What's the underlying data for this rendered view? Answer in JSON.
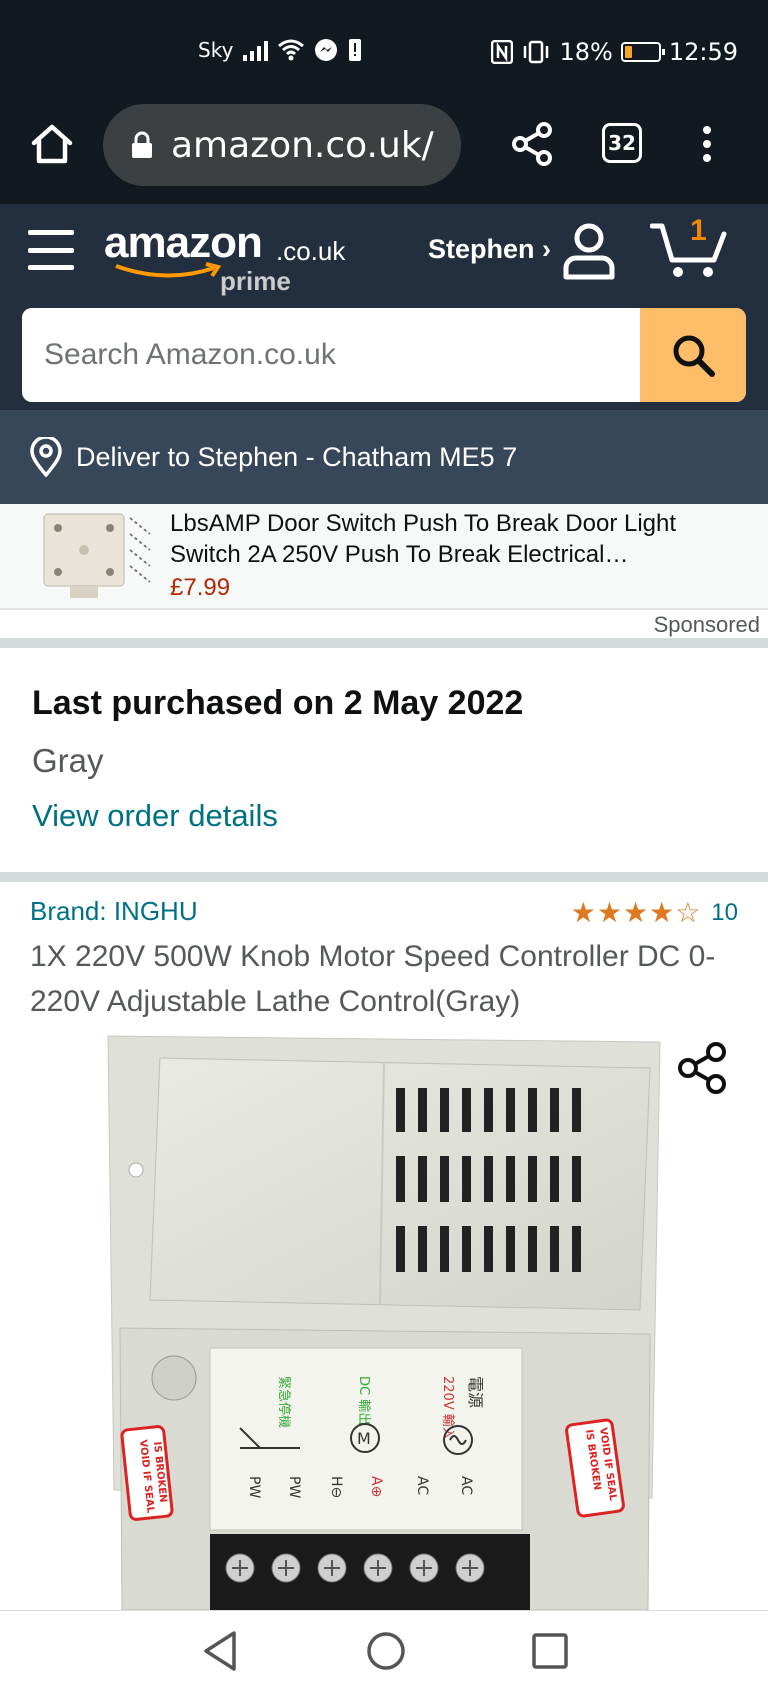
{
  "status_bar": {
    "carrier": "Sky",
    "battery_pct": "18%",
    "battery_level": 0.18,
    "time": "12:59"
  },
  "browser": {
    "url": "amazon.co.uk/",
    "tab_count": "32",
    "icons": [
      "home-icon",
      "lock-icon",
      "share-icon",
      "tabs-icon",
      "more-vert-icon"
    ]
  },
  "header": {
    "logo_text": "amazon",
    "logo_tld": ".co.uk",
    "logo_sub": "prime",
    "account_name": "Stephen ›",
    "cart_count": "1",
    "search_placeholder": "Search Amazon.co.uk"
  },
  "deliver": {
    "text": "Deliver to Stephen - Chatham ME5 7"
  },
  "ad": {
    "title": "LbsAMP Door Switch Push To Break Door Light Switch 2A 250V Push To Break Electrical…",
    "price": "£7.99",
    "sponsored_label": "Sponsored"
  },
  "purchase": {
    "title": "Last purchased on 2 May 2022",
    "variant": "Gray",
    "link": "View order details"
  },
  "product": {
    "brand": "Brand: INGHU",
    "stars": "★★★★☆",
    "rating_value": 4.5,
    "rating_count": "10",
    "title": "1X 220V 500W Knob Motor Speed Controller DC 0-220V Adjustable Lathe Control(Gray)",
    "image_labels": {
      "seal_left": "VOID IF SEAL IS BROKEN",
      "seal_right": "VOID IF SEAL IS BROKEN",
      "terminals": [
        "PW",
        "PW",
        "H⊖",
        "A⊕",
        "AC",
        "AC"
      ],
      "header_cn": [
        "緊急停機",
        "DC 輸出",
        "220V 輸入",
        "電源"
      ]
    }
  },
  "colors": {
    "header_bg": "#232F3E",
    "deliver_bg": "#37475A",
    "search_btn": "#FEBD69",
    "link": "#007185",
    "price": "#B12704",
    "star": "#DE7921"
  }
}
